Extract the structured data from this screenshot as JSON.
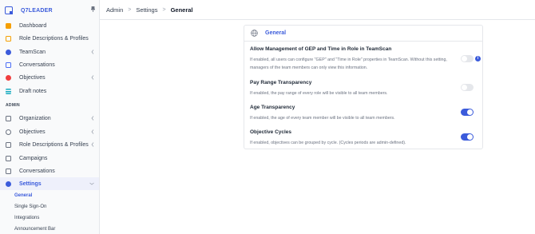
{
  "brand": {
    "name": "Q7LEADER"
  },
  "sidebar": {
    "main_items": [
      {
        "label": "Dashboard",
        "icon": "dashboard-icon"
      },
      {
        "label": "Role Descriptions & Profiles",
        "icon": "briefcase-icon"
      },
      {
        "label": "TeamScan",
        "icon": "teamscan-icon"
      },
      {
        "label": "Conversations",
        "icon": "chat-icon"
      },
      {
        "label": "Objectives",
        "icon": "target-icon"
      },
      {
        "label": "Draft notes",
        "icon": "notes-icon"
      }
    ],
    "admin_label": "ADMIN",
    "admin_items": [
      {
        "label": "Organization",
        "icon": "organization-icon"
      },
      {
        "label": "Objectives",
        "icon": "target-icon"
      },
      {
        "label": "Role Descriptions & Profiles",
        "icon": "briefcase-icon"
      },
      {
        "label": "Campaigns",
        "icon": "calendar-icon"
      },
      {
        "label": "Conversations",
        "icon": "chat-icon"
      },
      {
        "label": "Settings",
        "icon": "gear-icon"
      }
    ],
    "settings_sub": [
      {
        "label": "General"
      },
      {
        "label": "Single Sign-On"
      },
      {
        "label": "Integrations"
      },
      {
        "label": "Announcement Bar"
      }
    ]
  },
  "breadcrumb": [
    "Admin",
    "Settings",
    "General"
  ],
  "card": {
    "title": "General",
    "settings": [
      {
        "title": "Allow Management of GEP and Time in Role in TeamScan",
        "description": "If enabled, all users can configure \"GEP\" and \"Time in Role\" properties in TeamScan. Without this setting, managers of the team members can only view this information.",
        "enabled": false
      },
      {
        "title": "Pay Range Transparency",
        "description": "If enabled, the pay range of every role will be visible to all team members.",
        "enabled": false
      },
      {
        "title": "Age Transparency",
        "description": "If enabled, the age of every team member will be visible to all team members.",
        "enabled": true
      },
      {
        "title": "Objective Cycles",
        "description": "If enabled, objectives can be grouped by cycle. (Cycles periods are admin-defined).",
        "enabled": true
      }
    ]
  },
  "colors": {
    "accent": "#3b5bdb",
    "toggle_off": "#e5e7eb"
  }
}
